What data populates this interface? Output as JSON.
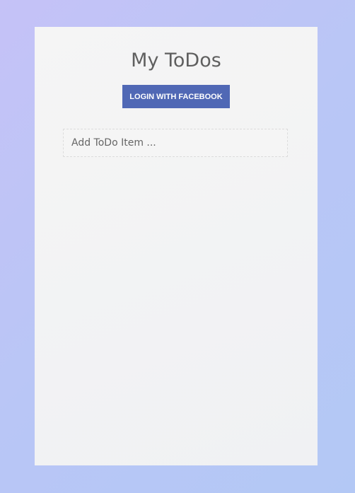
{
  "header": {
    "title": "My ToDos"
  },
  "auth": {
    "login_label": "LOGIN WITH FACEBOOK"
  },
  "todo": {
    "input_value": "",
    "placeholder": "Add ToDo Item ..."
  }
}
